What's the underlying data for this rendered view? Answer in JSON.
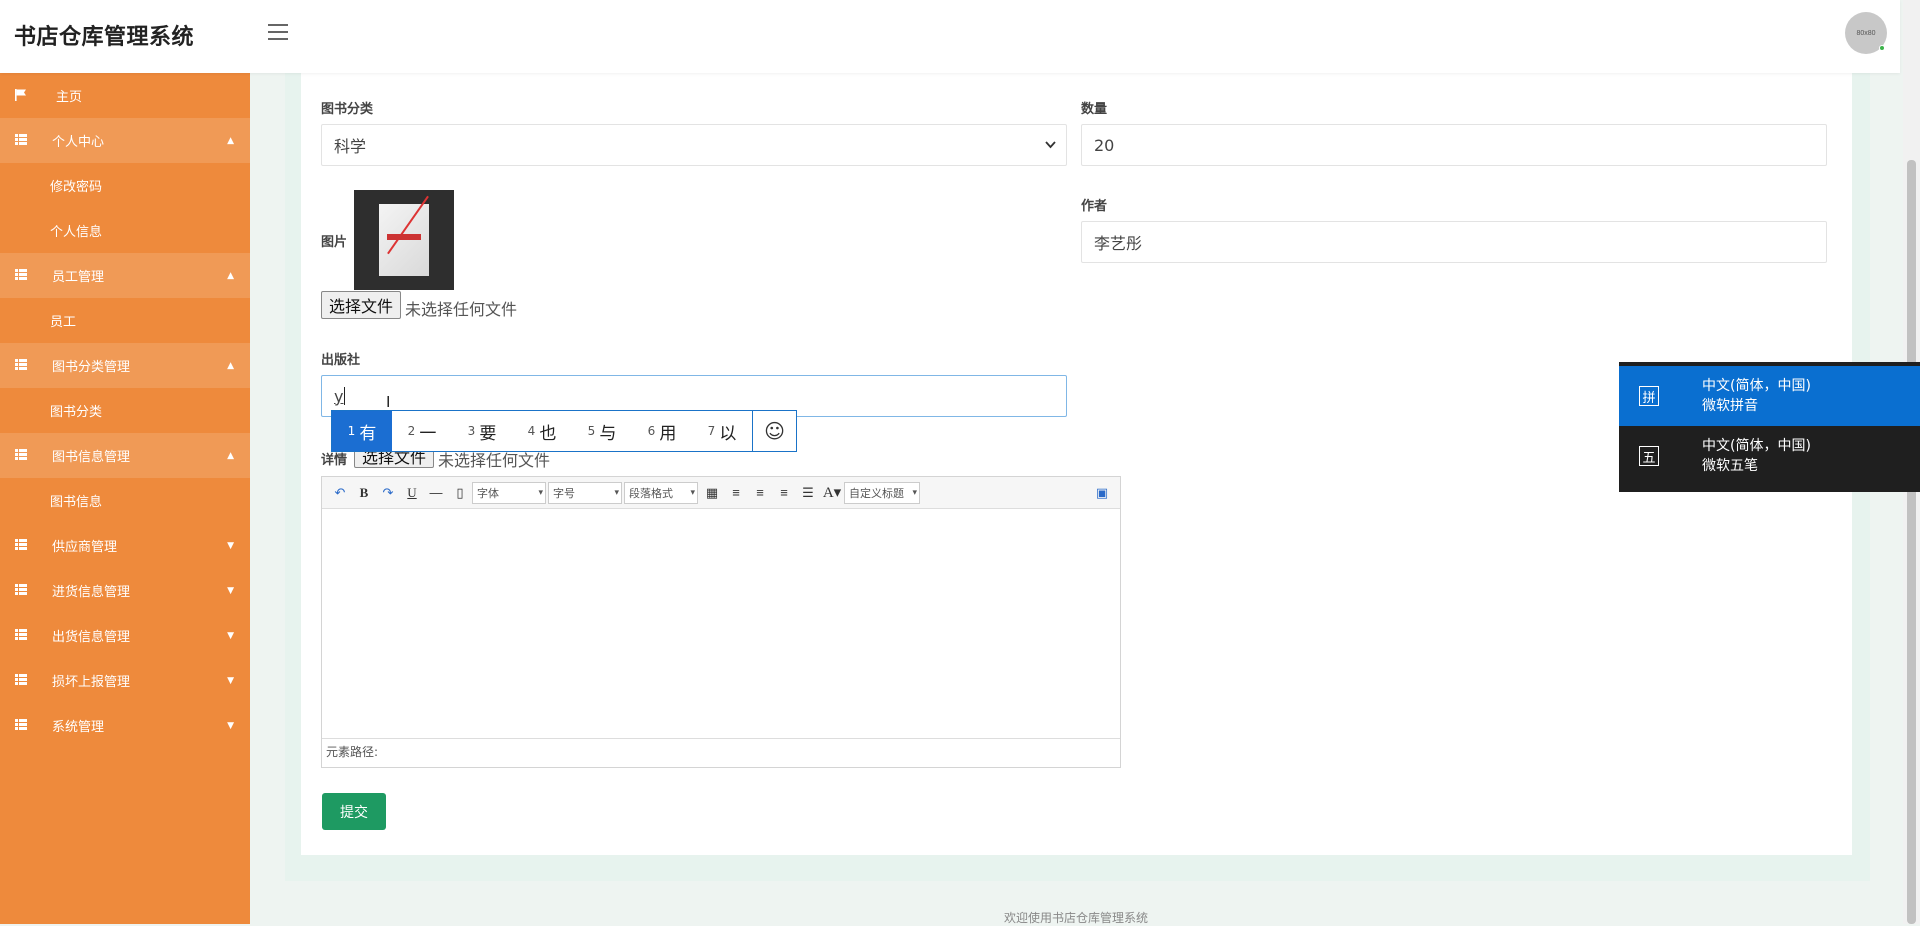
{
  "header": {
    "app_title": "书店仓库管理系统",
    "avatar_text": "80x80"
  },
  "sidebar": {
    "items": [
      {
        "label": "主页",
        "type": "item",
        "icon": "flag-icon"
      },
      {
        "label": "个人中心",
        "type": "parent",
        "open": true,
        "icon": "grid-icon"
      },
      {
        "label": "修改密码",
        "type": "sub"
      },
      {
        "label": "个人信息",
        "type": "sub"
      },
      {
        "label": "员工管理",
        "type": "parent",
        "open": true,
        "icon": "grid-icon"
      },
      {
        "label": "员工",
        "type": "sub"
      },
      {
        "label": "图书分类管理",
        "type": "parent",
        "open": true,
        "icon": "grid-icon"
      },
      {
        "label": "图书分类",
        "type": "sub"
      },
      {
        "label": "图书信息管理",
        "type": "parent",
        "open": true,
        "icon": "grid-icon"
      },
      {
        "label": "图书信息",
        "type": "sub"
      },
      {
        "label": "供应商管理",
        "type": "parent",
        "open": false,
        "icon": "grid-icon"
      },
      {
        "label": "进货信息管理",
        "type": "parent",
        "open": false,
        "icon": "grid-icon"
      },
      {
        "label": "出货信息管理",
        "type": "parent",
        "open": false,
        "icon": "grid-icon"
      },
      {
        "label": "损坏上报管理",
        "type": "parent",
        "open": false,
        "icon": "grid-icon"
      },
      {
        "label": "系统管理",
        "type": "parent",
        "open": false,
        "icon": "grid-icon"
      }
    ]
  },
  "form": {
    "category_label": "图书分类",
    "category_value": "科学",
    "quantity_label": "数量",
    "quantity_value": "20",
    "image_label": "图片",
    "author_label": "作者",
    "author_value": "李艺彤",
    "file_button": "选择文件",
    "file_none": "未选择任何文件",
    "publisher_label": "出版社",
    "publisher_value": "y",
    "details_label": "详情",
    "submit_label": "提交"
  },
  "ime": {
    "candidates": [
      {
        "num": "1",
        "char": "有"
      },
      {
        "num": "2",
        "char": "一"
      },
      {
        "num": "3",
        "char": "要"
      },
      {
        "num": "4",
        "char": "也"
      },
      {
        "num": "5",
        "char": "与"
      },
      {
        "num": "6",
        "char": "用"
      },
      {
        "num": "7",
        "char": "以"
      }
    ],
    "emoji": "☺",
    "languages": [
      {
        "icon": "拼",
        "line1": "中文(简体，中国)",
        "line2": "微软拼音",
        "active": true
      },
      {
        "icon": "五",
        "line1": "中文(简体，中国)",
        "line2": "微软五笔",
        "active": false
      }
    ]
  },
  "editor": {
    "font_select": "字体",
    "size_select": "字号",
    "para_select": "段落格式",
    "custom_title": "自定义标题",
    "status_path": "元素路径:"
  },
  "footer": {
    "text": "欢迎使用书店仓库管理系统"
  },
  "colors": {
    "sidebar_bg": "#ee8a3c",
    "submit_bg": "#1e9a62",
    "ime_active": "#0a6fd0"
  }
}
